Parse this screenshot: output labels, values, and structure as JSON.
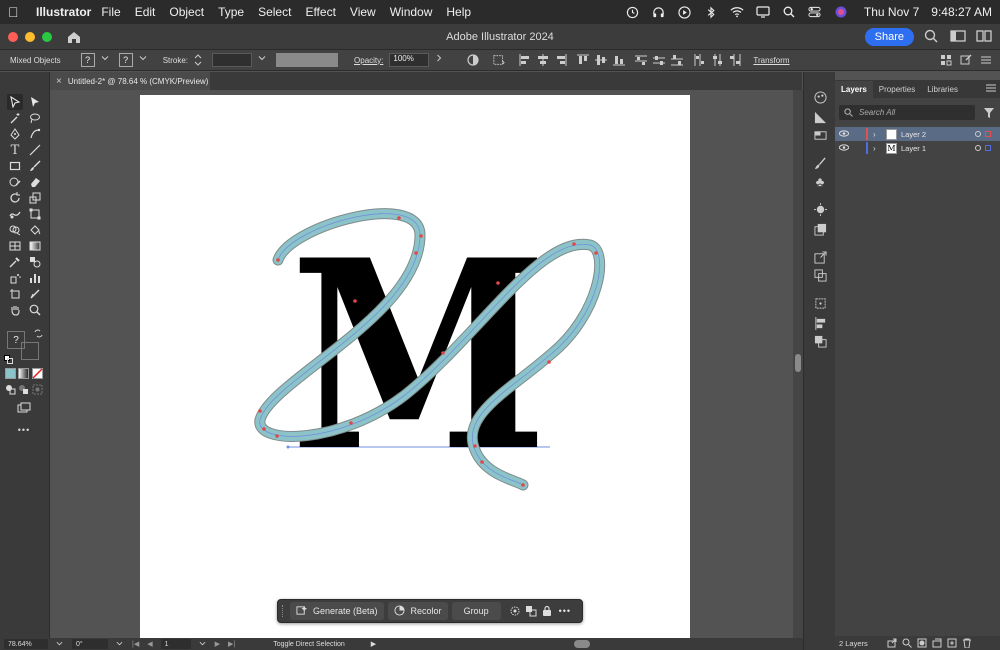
{
  "menubar": {
    "app_name": "Illustrator",
    "menus": [
      "File",
      "Edit",
      "Object",
      "Type",
      "Select",
      "Effect",
      "View",
      "Window",
      "Help"
    ],
    "date": "Thu Nov 7",
    "time": "9:48:27 AM"
  },
  "titlebar": {
    "title": "Adobe Illustrator 2024",
    "share_label": "Share"
  },
  "controlbar": {
    "selection_label": "Mixed Objects",
    "fill_placeholder": "?",
    "stroke_placeholder": "?",
    "stroke_label": "Stroke:",
    "opacity_label": "Opacity:",
    "opacity_value": "100%",
    "transform_label": "Transform"
  },
  "document": {
    "tab_label": "Untitled-2* @ 78.64 % (CMYK/Preview)",
    "close_glyph": "×",
    "artwork_letter": "M"
  },
  "toolbar": {
    "fill_stroke_label": "?",
    "more_label": "•••"
  },
  "taskbar": {
    "generate_label": "Generate (Beta)",
    "recolor_label": "Recolor",
    "group_label": "Group",
    "more_label": "•••"
  },
  "statusbar": {
    "zoom": "78.64%",
    "rotation": "0°",
    "artboard_number": "1",
    "current_tool": "Toggle Direct Selection"
  },
  "layers_panel": {
    "tabs": [
      "Layers",
      "Properties",
      "Libraries"
    ],
    "search_placeholder": "Search All",
    "layers": [
      {
        "name": "Layer 2",
        "color": "#e0524f",
        "selected": true
      },
      {
        "name": "Layer 1",
        "color": "#4f6fe0",
        "selected": false
      }
    ],
    "footer_count": "2 Layers"
  },
  "colors": {
    "accent": "#2d6ff0",
    "path_stroke": "#8cc3c8",
    "anchor_points": "#e04848",
    "baseline_guide": "#6f8fe0"
  }
}
